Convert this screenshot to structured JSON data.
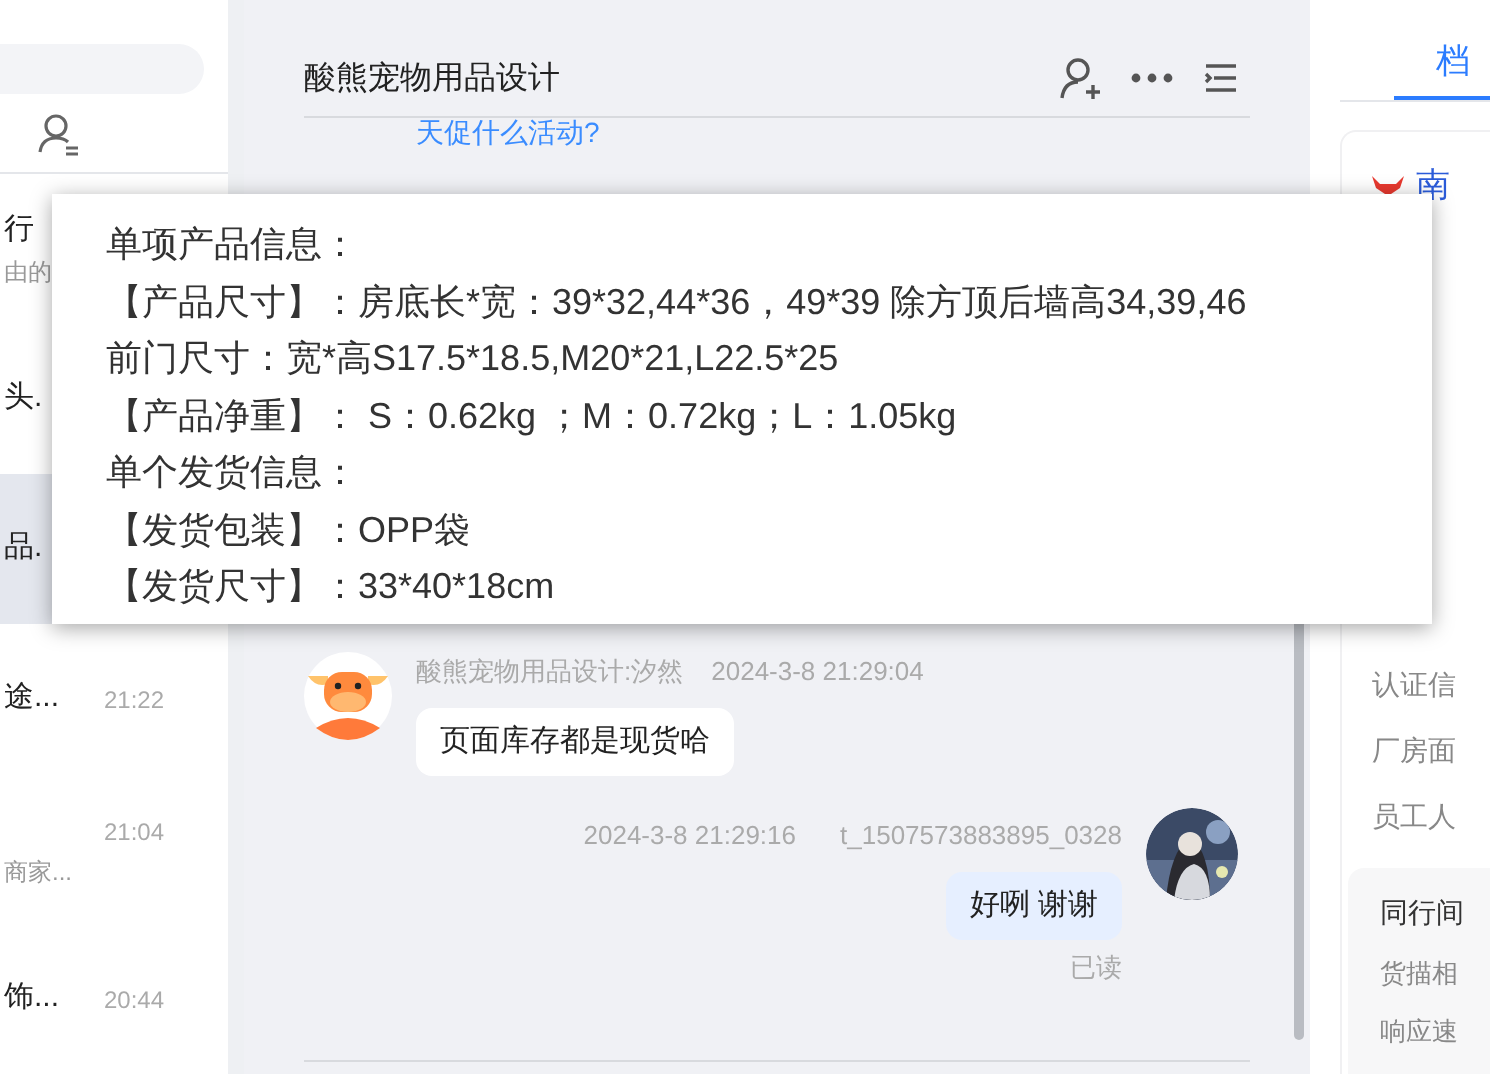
{
  "conversation_list": {
    "items": [
      {
        "title": "行",
        "subtitle": "由的",
        "selected": false
      },
      {
        "title": "头.",
        "selected": false
      },
      {
        "title": "品.",
        "selected": true
      },
      {
        "title": "途...",
        "time": "21:22",
        "selected": false
      },
      {
        "subtitle": "商家...",
        "time": "21:04",
        "selected": false
      },
      {
        "title": "饰...",
        "time": "20:44",
        "selected": false
      }
    ]
  },
  "chat": {
    "title": "酸熊宠物用品设计",
    "link_text": "天促什么活动?",
    "messages": [
      {
        "kind": "incoming",
        "sender": "酸熊宠物用品设计:汐然",
        "time": "2024-3-8 21:29:04",
        "text": "页面库存都是现货哈"
      },
      {
        "kind": "outgoing",
        "sender": "t_1507573883895_0328",
        "time": "2024-3-8 21:29:16",
        "text": "好咧 谢谢",
        "status": "已读"
      }
    ]
  },
  "popup": {
    "lines": [
      "单项产品信息：",
      "【产品尺寸】：房底长*宽：39*32,44*36，49*39 除方顶后墙高34,39,46",
      "前门尺寸：宽*高S17.5*18.5,M20*21,L22.5*25",
      "【产品净重】： S：0.62kg ；M：0.72kg；L：1.05kg",
      "单个发货信息：",
      "【发货包装】：OPP袋",
      "【发货尺寸】：33*40*18cm"
    ]
  },
  "profile": {
    "tabs": [
      {
        "label": "档",
        "selected": true
      }
    ],
    "shop_name": "南",
    "fields": [
      "认证信",
      "厂房面",
      "员工人"
    ],
    "card": {
      "title": "同行间",
      "rows": [
        "货描相",
        "响应速"
      ]
    }
  }
}
